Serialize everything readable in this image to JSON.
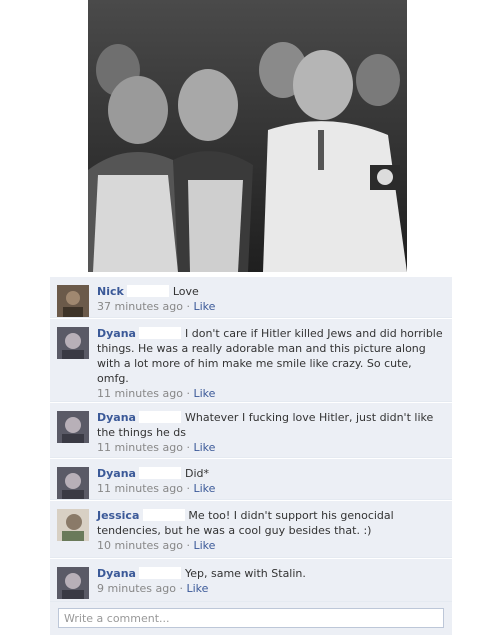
{
  "comments": [
    {
      "name": "Nick",
      "text": "Love",
      "time": "37 minutes ago",
      "like": "Like"
    },
    {
      "name": "Dyana",
      "text": "I don't care if Hitler killed Jews and did horrible things. He was a really adorable man and this picture along with a lot more of him make me smile like crazy. So cute, omfg.",
      "time": "11 minutes ago",
      "like": "Like"
    },
    {
      "name": "Dyana",
      "text": "Whatever I fucking love Hitler, just didn't like the things he ds",
      "time": "11 minutes ago",
      "like": "Like"
    },
    {
      "name": "Dyana",
      "text": "Did*",
      "time": "11 minutes ago",
      "like": "Like"
    },
    {
      "name": "Jessica",
      "text": "Me too! I didn't support his genocidal tendencies, but he was a cool guy besides that. :)",
      "time": "10 minutes ago",
      "like": "Like"
    },
    {
      "name": "Dyana",
      "text": "Yep, same with Stalin.",
      "time": "9 minutes ago",
      "like": "Like"
    }
  ],
  "separator": "·",
  "write_comment": {
    "placeholder": "Write a comment..."
  }
}
